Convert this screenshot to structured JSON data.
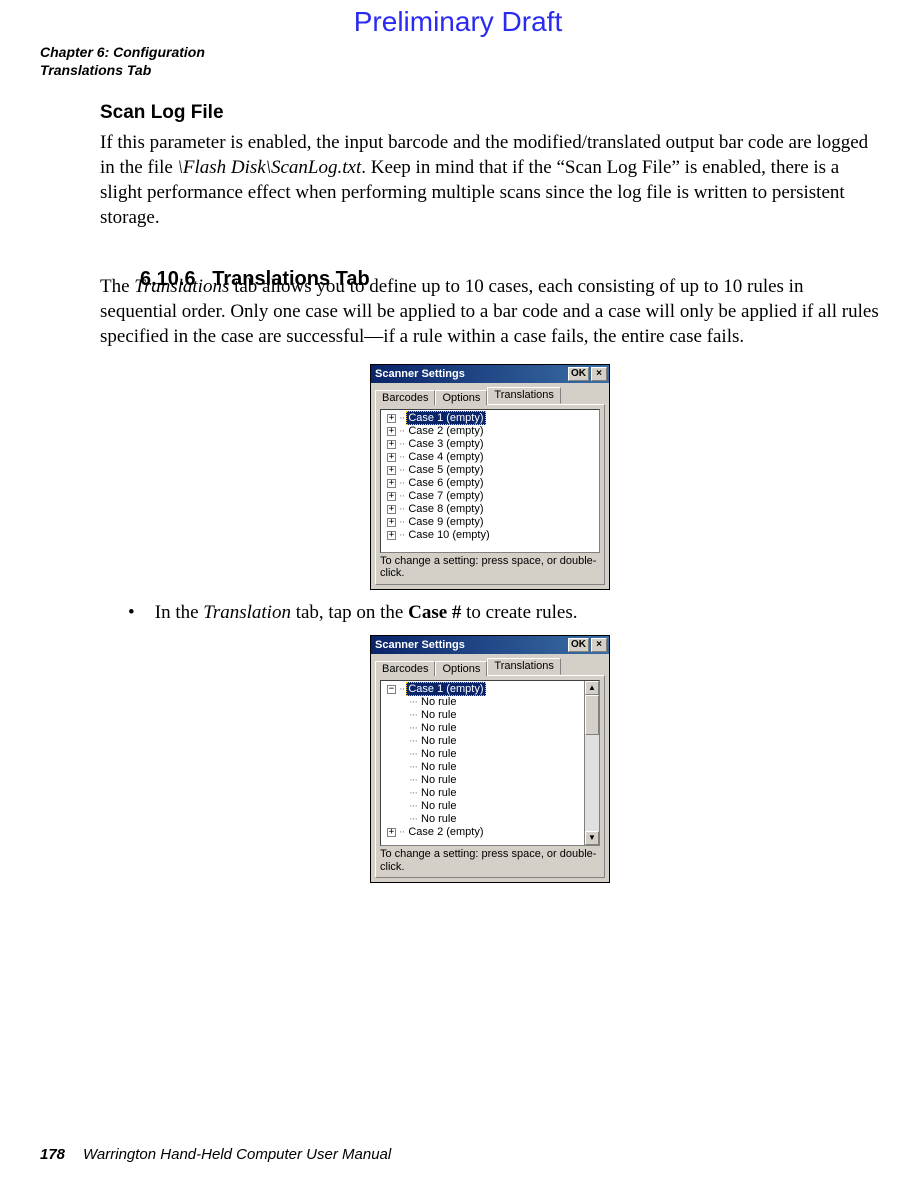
{
  "watermark": "Preliminary Draft",
  "header": {
    "line1": "Chapter 6:  Configuration",
    "line2": "Translations Tab"
  },
  "section_scanlog": {
    "title": "Scan Log File",
    "para_pre": "If this parameter is enabled, the input barcode and the modified/translated output bar code are logged in the file ",
    "para_italic": "\\Flash Disk\\ScanLog.txt",
    "para_post": ". Keep in mind that if the “Scan Log File” is enabled, there is a slight performance effect when performing multiple scans since the log file is written to persistent storage."
  },
  "section_trans": {
    "number": "6.10.6",
    "title": "Translations Tab",
    "para_pre": "The ",
    "para_italic": "Translations",
    "para_post": " tab allows you to define up to 10 cases, each consisting of up to 10 rules in sequential order. Only one case will be applied to a bar code and a case will only be applied if all rules specified in the case are successful—if a rule within a case fails, the entire case fails."
  },
  "bullet": {
    "pre": "In the ",
    "italic": "Translation",
    "mid": " tab, tap on the ",
    "bold": "Case #",
    "post": " to create rules."
  },
  "dialog": {
    "title": "Scanner Settings",
    "ok": "OK",
    "close": "×",
    "tabs": [
      "Barcodes",
      "Options",
      "Translations"
    ],
    "hint": "To change a setting: press space, or double-click.",
    "cases": [
      "Case 1 (empty)",
      "Case 2 (empty)",
      "Case 3 (empty)",
      "Case 4 (empty)",
      "Case 5 (empty)",
      "Case 6 (empty)",
      "Case 7 (empty)",
      "Case 8 (empty)",
      "Case 9 (empty)",
      "Case 10 (empty)"
    ],
    "expanded": {
      "case1": "Case 1 (empty)",
      "norule": "No rule",
      "case2": "Case 2 (empty)"
    },
    "exp_plus": "+",
    "exp_minus": "−",
    "arrow_up": "▲",
    "arrow_down": "▼"
  },
  "footer": {
    "page": "178",
    "title": "Warrington Hand-Held Computer User Manual"
  }
}
